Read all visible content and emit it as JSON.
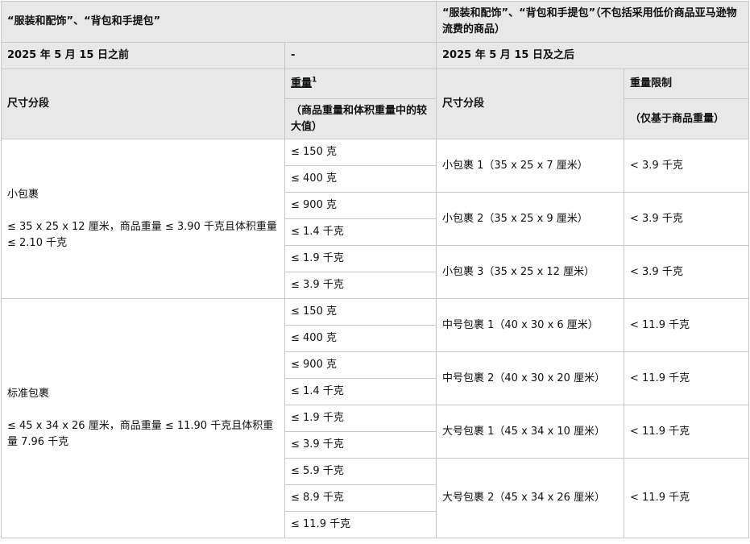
{
  "header": {
    "left_title": "“服装和配饰”、“背包和手提包”",
    "right_title": "“服装和配饰”、“背包和手提包”（不包括采用低价商品亚马逊物流费的商品）"
  },
  "date_row": {
    "before": "2025 年 5 月 15 日之前",
    "dash": "-",
    "after": "2025 年 5 月 15 日及之后"
  },
  "column_headers": {
    "left_tier": "尺寸分段",
    "weight": "重量",
    "weight_sup": "1",
    "weight_note": "（商品重量和体积重量中的较大值）",
    "right_tier": "尺寸分段",
    "weight_limit": "重量限制",
    "weight_limit_note": "（仅基于商品重量）"
  },
  "small_standard": {
    "name": "小包裹",
    "desc": "≤ 35 x 25 x 12 厘米，商品重量 ≤ 3.90 千克且体积重量 ≤ 2.10 千克",
    "weights": [
      "≤ 150 克",
      "≤ 400 克",
      "≤ 900 克",
      "≤ 1.4 千克",
      "≤ 1.9 千克",
      "≤ 3.9 千克"
    ],
    "new_tiers": [
      {
        "name": "小包裹 1（35 x 25 x 7 厘米）",
        "limit": "< 3.9 千克"
      },
      {
        "name": "小包裹 2（35 x 25 x 9 厘米）",
        "limit": "< 3.9 千克"
      },
      {
        "name": "小包裹 3（35 x 25 x 12 厘米）",
        "limit": "< 3.9 千克"
      }
    ]
  },
  "standard": {
    "name": "标准包裹",
    "desc": "≤ 45 x 34 x 26 厘米，商品重量 ≤ 11.90 千克且体积重量 7.96 千克",
    "weights": [
      "≤ 150 克",
      "≤ 400 克",
      "≤ 900 克",
      "≤ 1.4 千克",
      "≤ 1.9 千克",
      "≤ 3.9 千克",
      "≤ 5.9 千克",
      "≤ 8.9 千克",
      "≤ 11.9 千克"
    ],
    "new_tiers": [
      {
        "name": "中号包裹 1（40 x 30 x 6 厘米）",
        "limit": "< 11.9 千克"
      },
      {
        "name": "中号包裹 2（40 x 30 x 20 厘米）",
        "limit": "< 11.9 千克"
      },
      {
        "name": "大号包裹 1（45 x 34 x 10 厘米）",
        "limit": "< 11.9 千克"
      },
      {
        "name": "大号包裹 2（45 x 34 x 26 厘米）",
        "limit": "< 11.9 千克"
      }
    ]
  }
}
